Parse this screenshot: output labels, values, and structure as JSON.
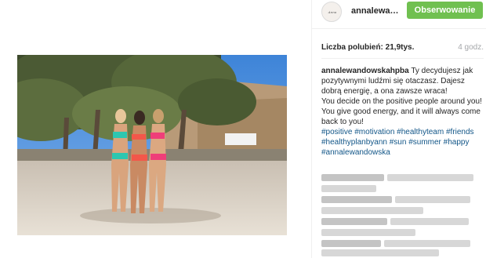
{
  "post": {
    "username": "annalewa…",
    "follow_label": "Obserwowanie",
    "likes_label": "Liczba polubień: 21,9tys.",
    "time_label": "4 godz.",
    "caption": {
      "username": "annalewandowskahpba",
      "text_pl": "Ty decydujesz jak pozytywnymi ludźmi się otaczasz. Dajesz dobrą energię, a ona zawsze wraca!",
      "text_en": "You decide on the positive people around you! You give good energy, and it will always come back to you!",
      "hashtags": "#positive #motivation #healthyteam #friends #healthyplanbyann #sun #summer #happy #annalewandowska"
    }
  },
  "colors": {
    "follow_bg": "#70c050",
    "hashtag": "#125688"
  }
}
